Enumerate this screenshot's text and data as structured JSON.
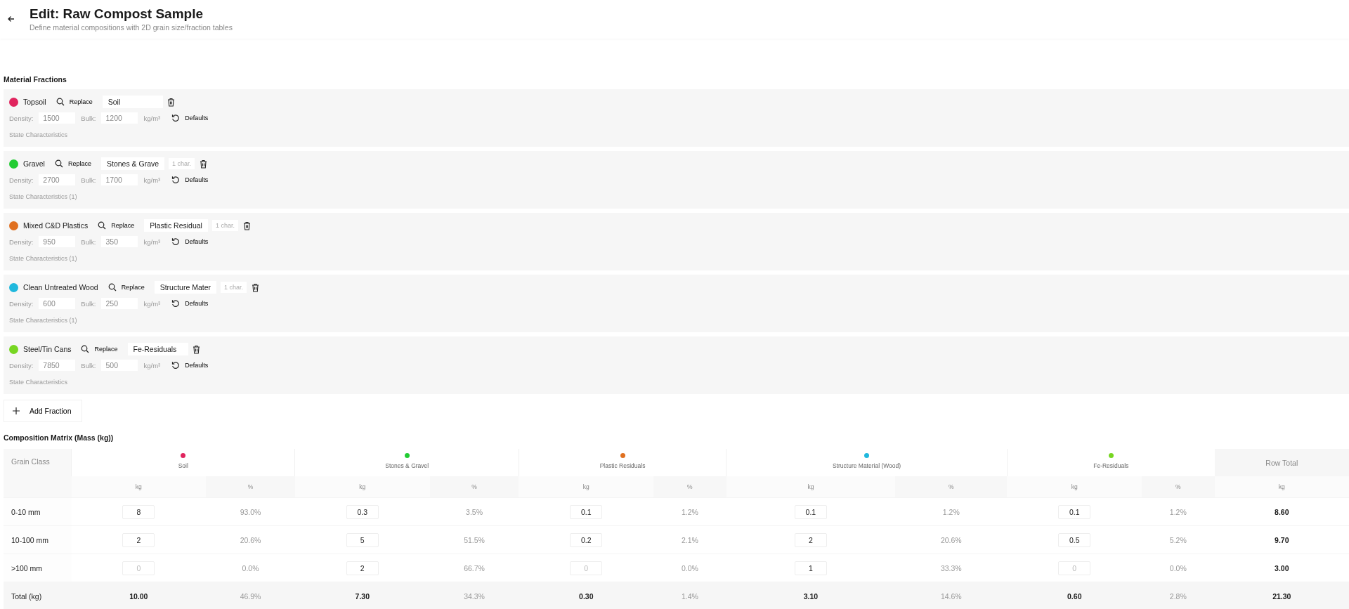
{
  "header": {
    "title": "Edit: Raw Compost Sample",
    "subtitle": "Define material compositions with 2D grain size/fraction tables"
  },
  "fractions_section": {
    "title": "Material Fractions",
    "add_label": "Add Fraction",
    "items": [
      {
        "name": "Topsoil",
        "color": "#e0245e",
        "replace": "Replace",
        "material": "Soil",
        "density_label": "Density:",
        "density": "1500",
        "bulk_label": "Bulk:",
        "bulk": "1200",
        "unit": "kg/m³",
        "defaults": "Defaults",
        "state": "State Characteristics"
      },
      {
        "name": "Gravel",
        "color": "#22cc33",
        "replace": "Replace",
        "material": "Stones & Grave",
        "note": "1 char.",
        "density_label": "Density:",
        "density": "2700",
        "bulk_label": "Bulk:",
        "bulk": "1700",
        "unit": "kg/m³",
        "defaults": "Defaults",
        "state": "State Characteristics (1)"
      },
      {
        "name": "Mixed C&D Plastics",
        "color": "#e07020",
        "replace": "Replace",
        "material": "Plastic Residual",
        "note": "1 char.",
        "density_label": "Density:",
        "density": "950",
        "bulk_label": "Bulk:",
        "bulk": "350",
        "unit": "kg/m³",
        "defaults": "Defaults",
        "state": "State Characteristics (1)"
      },
      {
        "name": "Clean Untreated Wood",
        "color": "#20b8dd",
        "replace": "Replace",
        "material": "Structure Mater",
        "note": "1 char.",
        "density_label": "Density:",
        "density": "600",
        "bulk_label": "Bulk:",
        "bulk": "250",
        "unit": "kg/m³",
        "defaults": "Defaults",
        "state": "State Characteristics (1)"
      },
      {
        "name": "Steel/Tin Cans",
        "color": "#77d622",
        "replace": "Replace",
        "material": "Fe-Residuals",
        "density_label": "Density:",
        "density": "7850",
        "bulk_label": "Bulk:",
        "bulk": "500",
        "unit": "kg/m³",
        "defaults": "Defaults",
        "state": "State Characteristics"
      }
    ]
  },
  "matrix": {
    "title": "Composition Matrix (Mass (kg))",
    "corner": "Grain Class",
    "total_heading": "Row Total",
    "total_unit": "kg",
    "columns": [
      {
        "name": "Soil",
        "color": "#e0245e",
        "kg_unit": "kg",
        "pct_unit": "%"
      },
      {
        "name": "Stones & Gravel",
        "color": "#22cc33",
        "kg_unit": "kg",
        "pct_unit": "%"
      },
      {
        "name": "Plastic Residuals",
        "color": "#e07020",
        "kg_unit": "kg",
        "pct_unit": "%"
      },
      {
        "name": "Structure Material (Wood)",
        "color": "#20b8dd",
        "kg_unit": "kg",
        "pct_unit": "%"
      },
      {
        "name": "Fe-Residuals",
        "color": "#77d622",
        "kg_unit": "kg",
        "pct_unit": "%"
      }
    ],
    "rows": [
      {
        "label": "0-10 mm",
        "cells": [
          {
            "kg": "8",
            "pct": "93.0%",
            "zero": false
          },
          {
            "kg": "0.3",
            "pct": "3.5%",
            "zero": false
          },
          {
            "kg": "0.1",
            "pct": "1.2%",
            "zero": false
          },
          {
            "kg": "0.1",
            "pct": "1.2%",
            "zero": false
          },
          {
            "kg": "0.1",
            "pct": "1.2%",
            "zero": false
          }
        ],
        "total": "8.60"
      },
      {
        "label": "10-100 mm",
        "cells": [
          {
            "kg": "2",
            "pct": "20.6%",
            "zero": false
          },
          {
            "kg": "5",
            "pct": "51.5%",
            "zero": false
          },
          {
            "kg": "0.2",
            "pct": "2.1%",
            "zero": false
          },
          {
            "kg": "2",
            "pct": "20.6%",
            "zero": false
          },
          {
            "kg": "0.5",
            "pct": "5.2%",
            "zero": false
          }
        ],
        "total": "9.70"
      },
      {
        "label": ">100 mm",
        "cells": [
          {
            "kg": "0",
            "pct": "0.0%",
            "zero": true
          },
          {
            "kg": "2",
            "pct": "66.7%",
            "zero": false
          },
          {
            "kg": "0",
            "pct": "0.0%",
            "zero": true
          },
          {
            "kg": "1",
            "pct": "33.3%",
            "zero": false
          },
          {
            "kg": "0",
            "pct": "0.0%",
            "zero": true
          }
        ],
        "total": "3.00"
      }
    ],
    "total_row": {
      "label": "Total (kg)",
      "cells": [
        {
          "kg": "10.00",
          "pct": "46.9%"
        },
        {
          "kg": "7.30",
          "pct": "34.3%"
        },
        {
          "kg": "0.30",
          "pct": "1.4%"
        },
        {
          "kg": "3.10",
          "pct": "14.6%"
        },
        {
          "kg": "0.60",
          "pct": "2.8%"
        }
      ],
      "total": "21.30"
    }
  }
}
